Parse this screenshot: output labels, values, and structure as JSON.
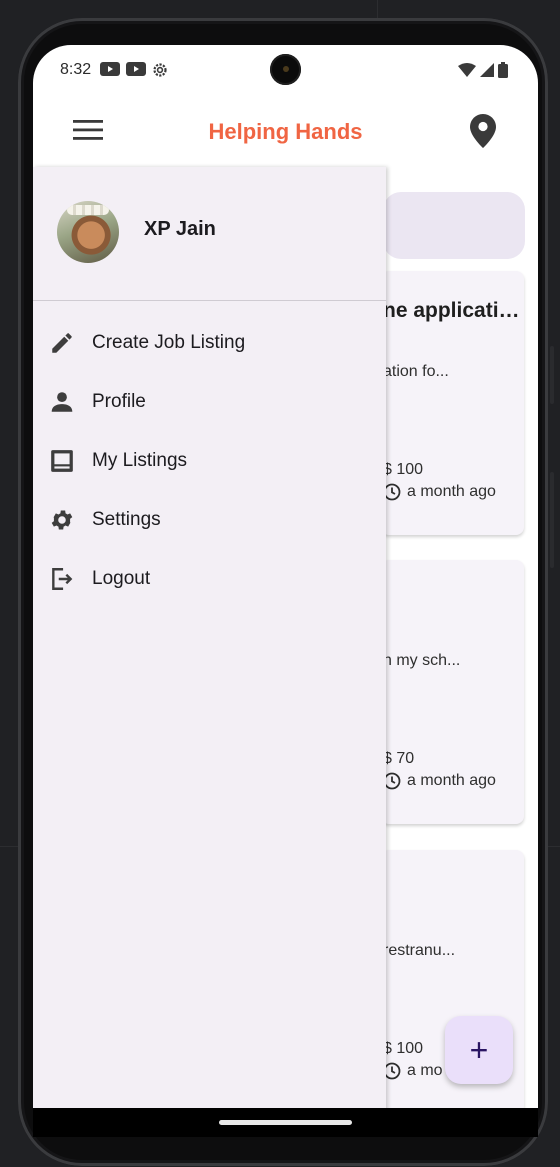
{
  "status_bar": {
    "time": "8:32"
  },
  "app_bar": {
    "title": "Helping Hands",
    "title_color": "#f06543"
  },
  "drawer": {
    "user": {
      "name": "XP Jain"
    },
    "items": [
      {
        "label": "Create Job Listing",
        "icon": "pencil-icon"
      },
      {
        "label": "Profile",
        "icon": "person-icon"
      },
      {
        "label": "My Listings",
        "icon": "listings-icon"
      },
      {
        "label": "Settings",
        "icon": "gear-icon"
      },
      {
        "label": "Logout",
        "icon": "logout-icon"
      }
    ]
  },
  "listings": [
    {
      "title": "ne applicati…",
      "description": "ation fo...",
      "price": "$ 100",
      "posted": "a month ago"
    },
    {
      "title": "",
      "description": "n my sch...",
      "price": "$ 70",
      "posted": "a month ago"
    },
    {
      "title": "",
      "description": "restranu...",
      "price": "$ 100",
      "posted": "a mo"
    }
  ],
  "fab": {
    "label": "+"
  }
}
